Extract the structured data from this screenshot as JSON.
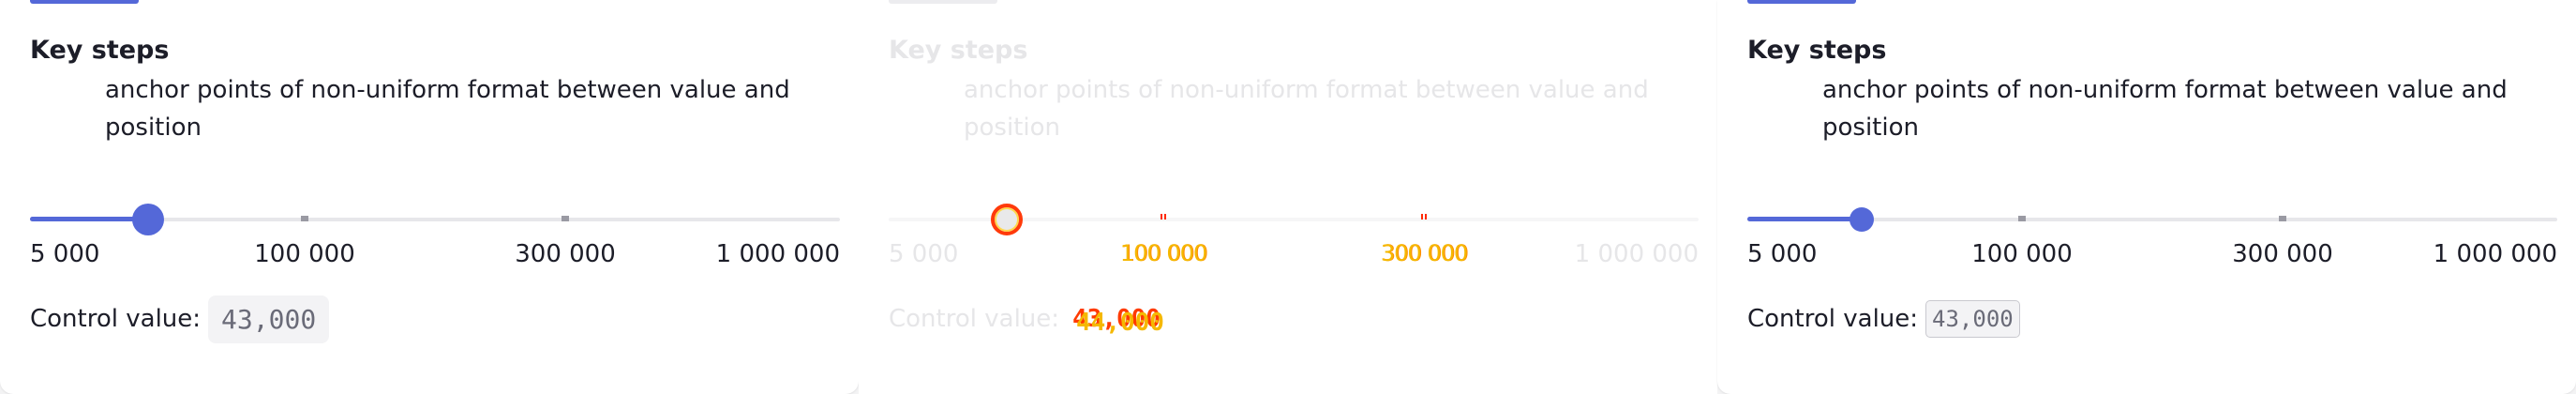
{
  "panels": [
    {
      "heading": "Key steps",
      "description": "anchor points of non-uniform format between value and position",
      "slider": {
        "labels": [
          "5 000",
          "100 000",
          "300 000",
          "1 000 000"
        ],
        "value": 43000
      },
      "control_label": "Control value:",
      "control_value": "43,000"
    },
    {
      "heading": "Key steps",
      "description": "anchor points of non-uniform format between value and position",
      "slider": {
        "labels": [
          "5 000",
          "100 000",
          "300 000",
          "1 000 000"
        ],
        "value": 43000
      },
      "control_label": "Control value:",
      "control_value": "43,000",
      "control_value_overlay": "44,000"
    },
    {
      "heading": "Key steps",
      "description": "anchor points of non-uniform format between value and position",
      "slider": {
        "labels": [
          "5 000",
          "100 000",
          "300 000",
          "1 000 000"
        ],
        "value": 43000
      },
      "control_label": "Control value:",
      "control_value": "43,000"
    }
  ],
  "colors": {
    "accent": "#5468d8",
    "diff_red": "#ff3a0a",
    "diff_yellow": "#f5b800"
  }
}
